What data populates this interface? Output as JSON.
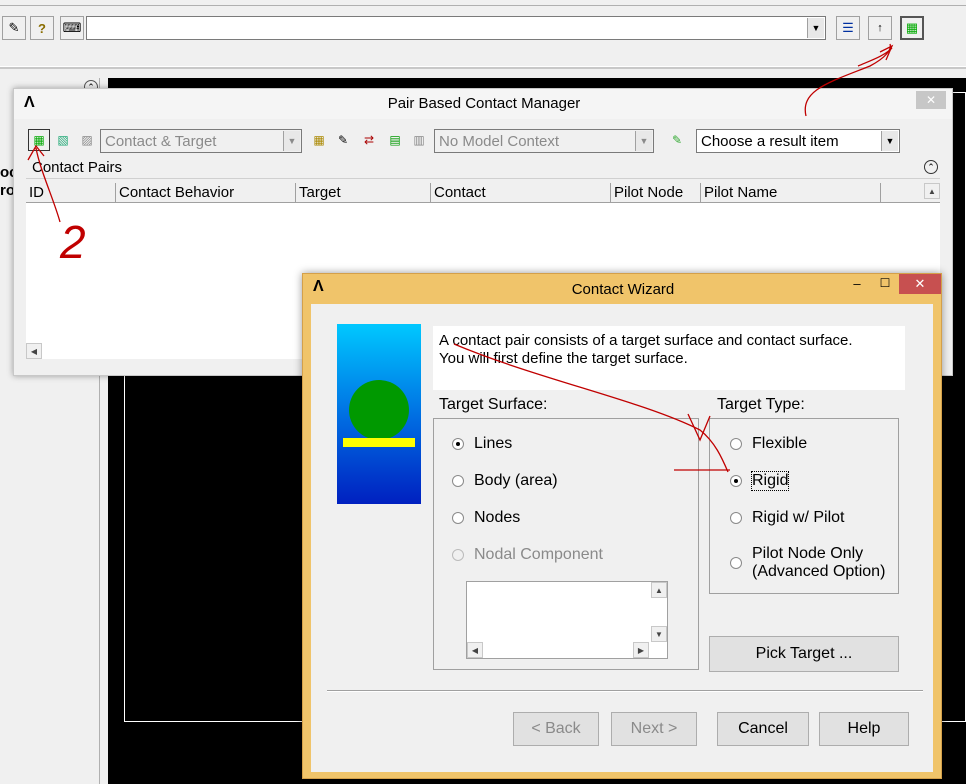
{
  "toolbar": {
    "command_value": "",
    "icons": [
      "edit-icon",
      "help-icon",
      "keyboard-icon",
      "dropdown-arrow-icon",
      "raise-hidden-icon",
      "reset-picking-icon",
      "contact-manager-icon"
    ]
  },
  "pbcm": {
    "title": "Pair Based Contact Manager",
    "close_glyph": "✕",
    "contact_combo": "Contact & Target",
    "context_combo": "No Model Context",
    "result_combo": "Choose a result item",
    "section_label": "Contact Pairs",
    "columns": [
      "ID",
      "Contact Behavior",
      "Target",
      "Contact",
      "Pilot Node",
      "Pilot Name"
    ]
  },
  "left_panel": {
    "fragment1": "oc",
    "fragment2": "ro"
  },
  "wizard": {
    "title": "Contact Wizard",
    "min_glyph": "–",
    "max_glyph": "☐",
    "close_glyph": "✕",
    "description_line1": "A contact pair consists of a target surface and contact surface.",
    "description_line2": "You will first define the target surface.",
    "target_surface_label": "Target Surface:",
    "target_surface_options": [
      {
        "label": "Lines",
        "selected": true,
        "disabled": false
      },
      {
        "label": "Body (area)",
        "selected": false,
        "disabled": false
      },
      {
        "label": "Nodes",
        "selected": false,
        "disabled": false
      },
      {
        "label": "Nodal Component",
        "selected": false,
        "disabled": true
      }
    ],
    "target_type_label": "Target Type:",
    "target_type_options": [
      {
        "label": "Flexible",
        "selected": false
      },
      {
        "label": "Rigid",
        "selected": true
      },
      {
        "label": "Rigid w/ Pilot",
        "selected": false
      },
      {
        "label": "Pilot Node Only",
        "label2": "(Advanced Option)",
        "selected": false
      }
    ],
    "pick_target": "Pick Target ...",
    "back": "< Back",
    "next": "Next >",
    "cancel": "Cancel",
    "help": "Help"
  },
  "annotation_number": "2",
  "colors": {
    "wizard_frame": "#f0c46a",
    "illustration_top": "#00c0ff",
    "illustration_bottom": "#0020c0",
    "circle": "#009900",
    "bar": "#ffff00",
    "annotation": "#c00000"
  }
}
